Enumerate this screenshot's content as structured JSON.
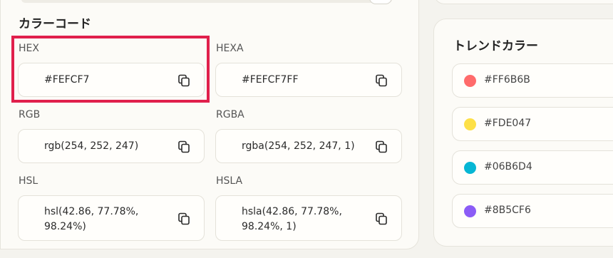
{
  "color_code": {
    "section_title": "カラーコード",
    "fields": {
      "hex": {
        "label": "HEX",
        "value": "#FEFCF7"
      },
      "hexa": {
        "label": "HEXA",
        "value": "#FEFCF7FF"
      },
      "rgb": {
        "label": "RGB",
        "value": "rgb(254, 252, 247)"
      },
      "rgba": {
        "label": "RGBA",
        "value": "rgba(254, 252, 247, 1)"
      },
      "hsl": {
        "label": "HSL",
        "value_line1": "hsl(42.86, 77.78%,",
        "value_line2": "98.24%)"
      },
      "hsla": {
        "label": "HSLA",
        "value_line1": "hsla(42.86, 77.78%,",
        "value_line2": "98.24%, 1)"
      }
    },
    "copy_icon": "copy-icon"
  },
  "trend": {
    "title": "トレンドカラー",
    "items": [
      {
        "label": "#FF6B6B",
        "color": "#FF6B6B"
      },
      {
        "label": "#FDE047",
        "color": "#FDE047"
      },
      {
        "label": "#06B6D4",
        "color": "#06B6D4"
      },
      {
        "label": "#8B5CF6",
        "color": "#8B5CF6"
      }
    ]
  },
  "colors": {
    "highlight": "#e0204c",
    "background": "#FEFCF7"
  }
}
